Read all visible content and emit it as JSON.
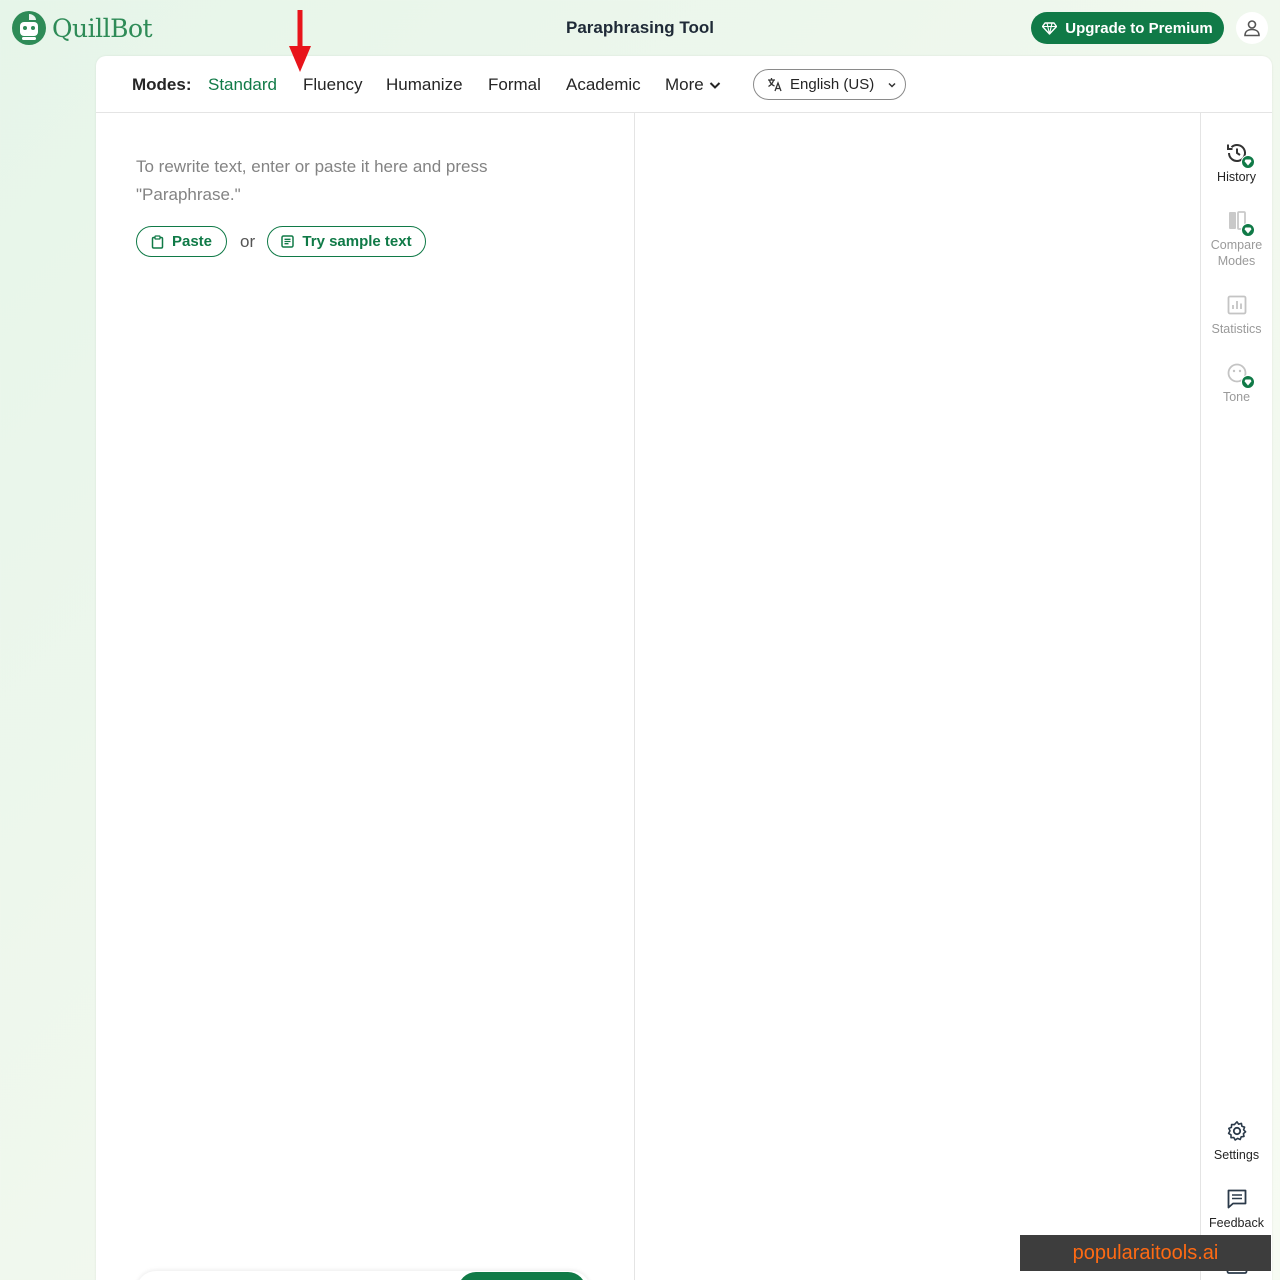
{
  "app": {
    "brand_name": "QuillBot",
    "page_title": "Paraphrasing Tool",
    "upgrade_label": "Upgrade to Premium",
    "account_icon": "user-icon"
  },
  "modes_bar": {
    "label": "Modes:",
    "modes": [
      "Standard",
      "Fluency",
      "Humanize",
      "Formal",
      "Academic"
    ],
    "active_mode": "Standard",
    "more_label": "More",
    "language": "English (US)"
  },
  "input_panel": {
    "placeholder": "To rewrite text, enter or paste it here and press \"Paraphrase.\"",
    "paste_label": "Paste",
    "or_label": "or",
    "sample_label": "Try sample text"
  },
  "sidebar": {
    "top_items": [
      {
        "label": "History",
        "icon": "history-icon",
        "premium": true,
        "enabled": true
      },
      {
        "label": "Compare Modes",
        "icon": "compare-icon",
        "premium": true,
        "enabled": false
      },
      {
        "label": "Statistics",
        "icon": "statistics-icon",
        "premium": false,
        "enabled": false
      },
      {
        "label": "Tone",
        "icon": "tone-icon",
        "premium": true,
        "enabled": false
      }
    ],
    "bottom_items": [
      {
        "label": "Settings",
        "icon": "gear-icon"
      },
      {
        "label": "Feedback",
        "icon": "feedback-icon"
      }
    ]
  },
  "overlay": {
    "watermark": "popularaitools.ai",
    "annotation_arrow_color": "#e8141b"
  },
  "colors": {
    "brand_green": "#107a47",
    "text_dark": "#252525",
    "placeholder_gray": "#838383"
  }
}
